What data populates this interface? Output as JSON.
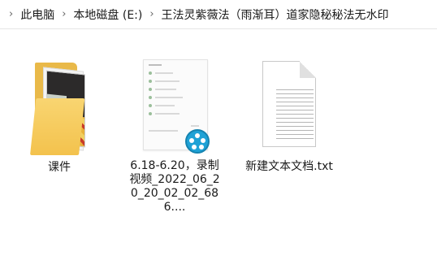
{
  "breadcrumb": {
    "separator": "›",
    "items": [
      "此电脑",
      "本地磁盘 (E:)",
      "王法灵紫薇法（雨渐耳）道家隐秘秘法无水印"
    ]
  },
  "files": [
    {
      "name": "课件",
      "type": "folder",
      "icon": "folder-icon"
    },
    {
      "name": "6.18-6.20，录制视频_2022_06_20_20_02_02_686....",
      "type": "video",
      "icon": "video-file-icon"
    },
    {
      "name": "新建文本文档.txt",
      "type": "text",
      "icon": "text-file-icon"
    }
  ]
}
